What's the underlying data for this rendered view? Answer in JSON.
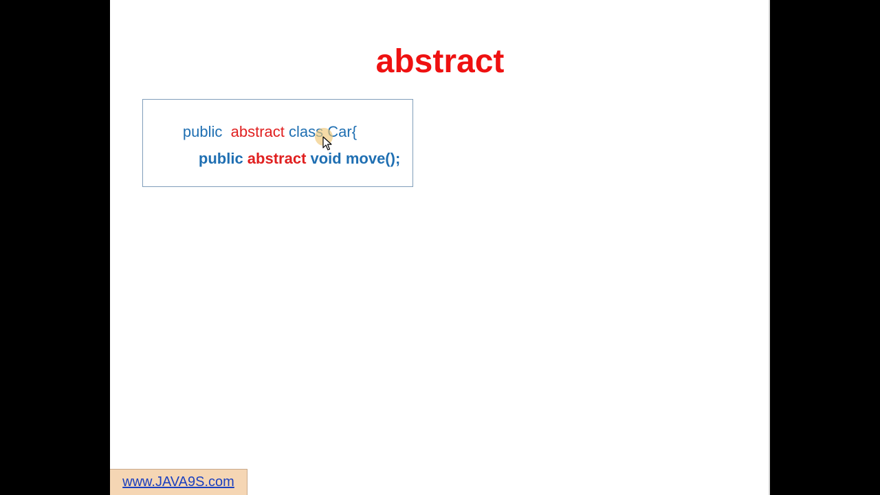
{
  "slide": {
    "title": "abstract",
    "code": {
      "line1": [
        {
          "text": "public  ",
          "color": "#1f6fb2"
        },
        {
          "text": "abstract",
          "color": "#e02020"
        },
        {
          "text": " class Car{",
          "color": "#1f6fb2"
        }
      ],
      "line2": [
        {
          "text": "public ",
          "color": "#1f6fb2"
        },
        {
          "text": "abstract",
          "color": "#e02020"
        },
        {
          "text": " void move();",
          "color": "#1f6fb2"
        }
      ]
    },
    "footer_link": "www.JAVA9S.com"
  },
  "colors": {
    "title": "#ee1111",
    "keyword_blue": "#1f6fb2",
    "keyword_red": "#e02020",
    "link": "#1a3fbf",
    "background": "#000000",
    "slide_background": "#ffffff"
  },
  "icons": {
    "cursor": "mouse-pointer-icon"
  }
}
